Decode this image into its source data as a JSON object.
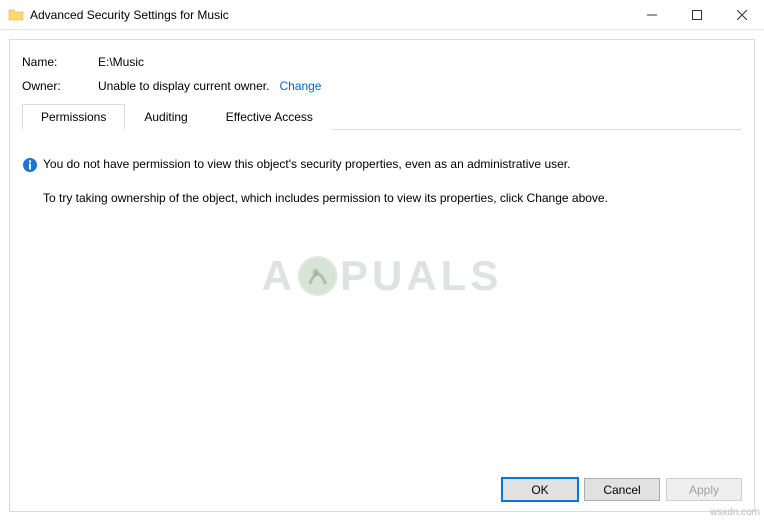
{
  "window": {
    "title": "Advanced Security Settings for Music"
  },
  "header": {
    "name_label": "Name:",
    "name_value": "E:\\Music",
    "owner_label": "Owner:",
    "owner_value": "Unable to display current owner.",
    "change_link": "Change"
  },
  "tabs": {
    "permissions": "Permissions",
    "auditing": "Auditing",
    "effective": "Effective Access"
  },
  "messages": {
    "info": "You do not have permission to view this object's security properties, even as an administrative user.",
    "hint": "To try taking ownership of the object, which includes permission to view its properties, click Change above."
  },
  "buttons": {
    "ok": "OK",
    "cancel": "Cancel",
    "apply": "Apply"
  },
  "watermark": {
    "pre": "A",
    "post": "PUALS"
  },
  "source": "wsxdn.com"
}
